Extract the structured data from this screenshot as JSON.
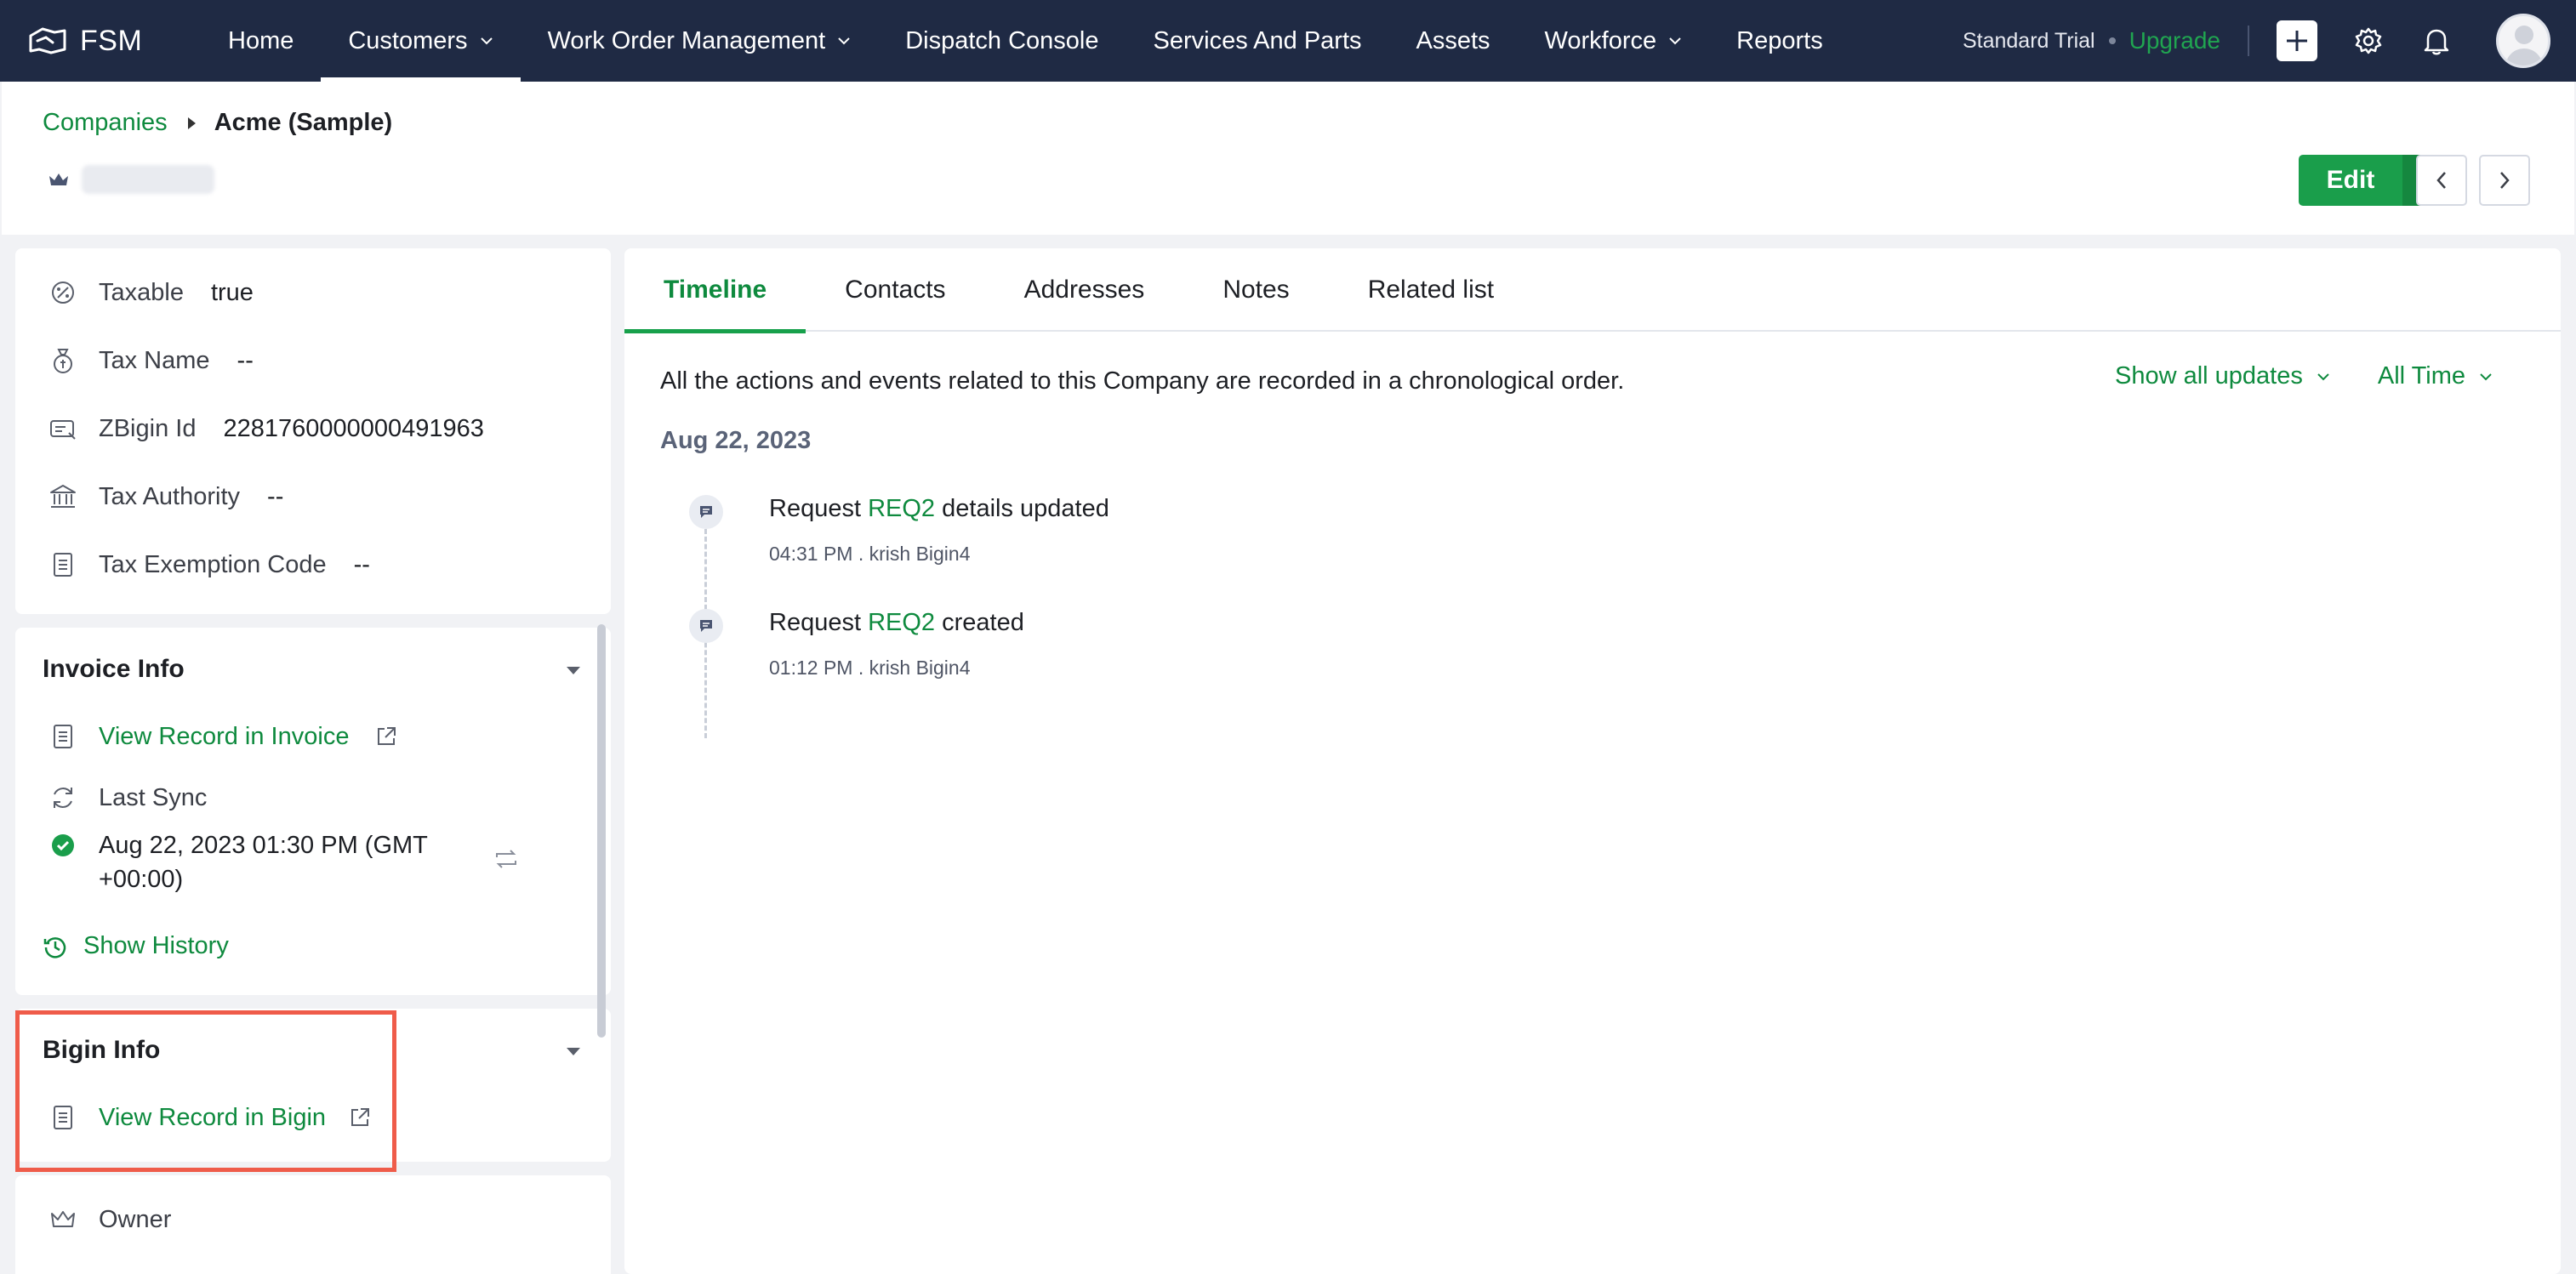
{
  "app": {
    "brand": "FSM"
  },
  "nav": {
    "items": [
      {
        "label": "Home",
        "dropdown": false,
        "active": false
      },
      {
        "label": "Customers",
        "dropdown": true,
        "active": true
      },
      {
        "label": "Work Order Management",
        "dropdown": true,
        "active": false
      },
      {
        "label": "Dispatch Console",
        "dropdown": false,
        "active": false
      },
      {
        "label": "Services And Parts",
        "dropdown": false,
        "active": false
      },
      {
        "label": "Assets",
        "dropdown": false,
        "active": false
      },
      {
        "label": "Workforce",
        "dropdown": true,
        "active": false
      },
      {
        "label": "Reports",
        "dropdown": false,
        "active": false
      }
    ],
    "trial_label": "Standard Trial",
    "upgrade_label": "Upgrade"
  },
  "header": {
    "breadcrumb_parent": "Companies",
    "breadcrumb_current": "Acme (Sample)",
    "edit_label": "Edit"
  },
  "left": {
    "fields": [
      {
        "label": "Taxable",
        "value": "true",
        "icon": "tax-icon"
      },
      {
        "label": "Tax Name",
        "value": "--",
        "icon": "tax-name-icon"
      },
      {
        "label": "ZBigin Id",
        "value": "2281760000000491963",
        "icon": "id-card-icon"
      },
      {
        "label": "Tax Authority",
        "value": "--",
        "icon": "bank-icon"
      },
      {
        "label": "Tax Exemption Code",
        "value": "--",
        "icon": "document-icon"
      }
    ],
    "invoice": {
      "title": "Invoice Info",
      "view_link": "View Record in Invoice",
      "last_sync_label": "Last Sync",
      "sync_time_line1": "Aug 22, 2023 01:30 PM (GMT",
      "sync_time_line2": "+00:00)",
      "history_link": "Show History"
    },
    "bigin": {
      "title": "Bigin Info",
      "view_link": "View Record in Bigin"
    },
    "owner_label": "Owner"
  },
  "tabs": [
    {
      "label": "Timeline",
      "active": true
    },
    {
      "label": "Contacts",
      "active": false
    },
    {
      "label": "Addresses",
      "active": false
    },
    {
      "label": "Notes",
      "active": false
    },
    {
      "label": "Related list",
      "active": false
    }
  ],
  "timeline": {
    "intro": "All the actions and events related to this Company are recorded in a chronological order.",
    "filter_updates": "Show all updates",
    "filter_time": "All Time",
    "date": "Aug 22, 2023",
    "events": [
      {
        "prefix": "Request",
        "link": "REQ2",
        "suffix": "details updated",
        "meta": "04:31 PM . krish Bigin4"
      },
      {
        "prefix": "Request",
        "link": "REQ2",
        "suffix": "created",
        "meta": "01:12 PM . krish Bigin4"
      }
    ]
  },
  "colors": {
    "nav_bg": "#1f2a44",
    "accent_green": "#0e8a3e",
    "highlight_red": "#ef5c4a"
  }
}
